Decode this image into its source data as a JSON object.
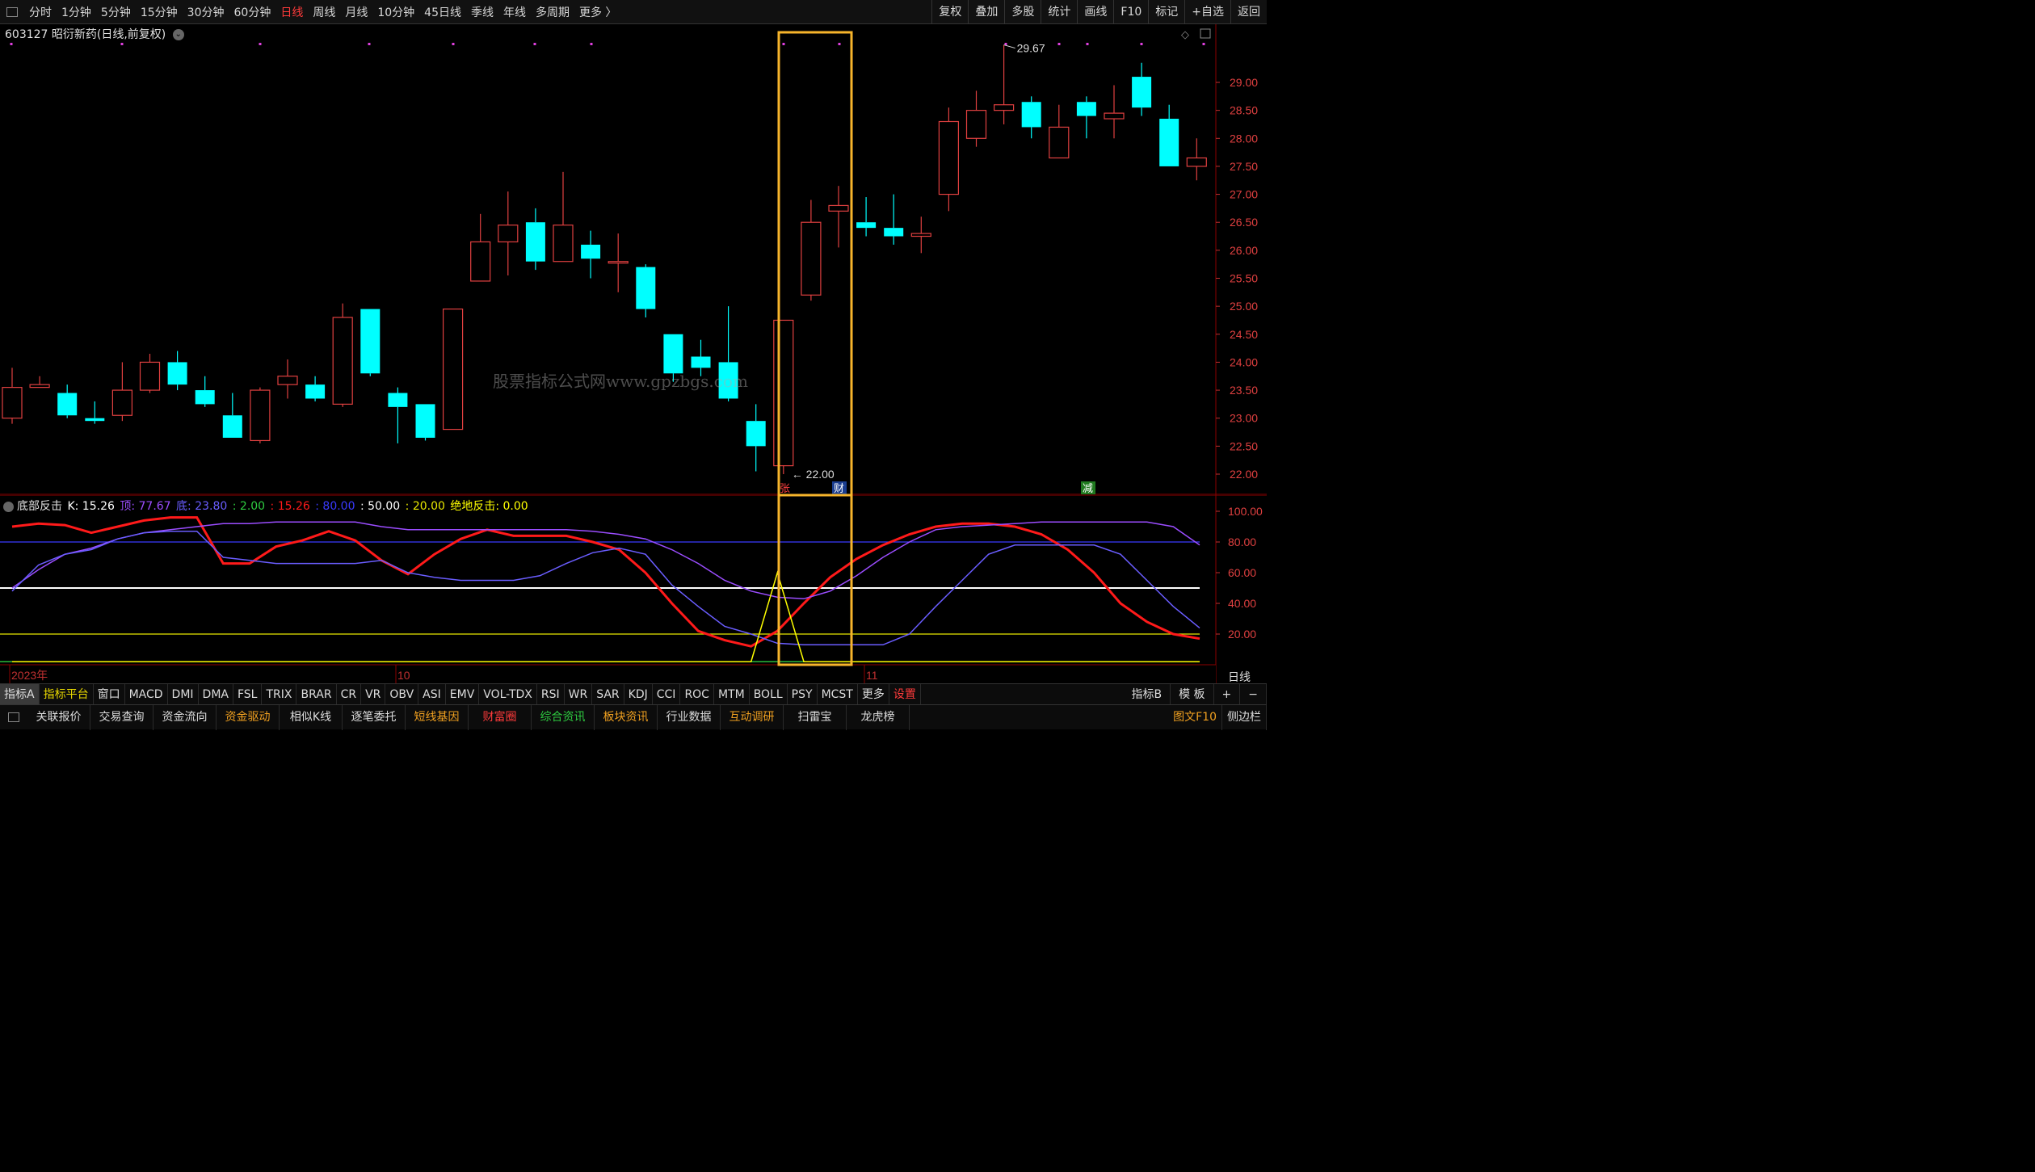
{
  "topbar": {
    "periods": [
      "分时",
      "1分钟",
      "5分钟",
      "15分钟",
      "30分钟",
      "60分钟",
      "日线",
      "周线",
      "月线",
      "10分钟",
      "45日线",
      "季线",
      "年线",
      "多周期",
      "更多 〉"
    ],
    "active": "日线",
    "right_buttons": [
      "复权",
      "叠加",
      "多股",
      "统计",
      "画线",
      "F10",
      "标记",
      "+自选",
      "返回"
    ]
  },
  "stock": {
    "title": "603127 昭衍新药(日线,前复权)",
    "dropdown_icon": "chevron-down-icon"
  },
  "watermark": "股票指标公式网www.gpzbgs.com",
  "colors": {
    "up": "#e04040",
    "down": "#00ffff",
    "highlight": "#f7b52b",
    "k": "#ff1a1a",
    "top": "#9b4dff",
    "bottom": "#5a4dff",
    "signal": "#ffff00",
    "grid_red": "#8b0000"
  },
  "chart_data": [
    {
      "type": "candlestick",
      "title": "603127 昭衍新药(日线,前复权)",
      "y_ticks": [
        "22.00",
        "22.50",
        "23.00",
        "23.50",
        "24.00",
        "24.50",
        "25.00",
        "25.50",
        "26.00",
        "26.50",
        "27.00",
        "27.50",
        "28.00",
        "28.50",
        "29.00"
      ],
      "ylim": [
        21.8,
        29.9
      ],
      "x_labels": [
        "2023年",
        "10",
        "11"
      ],
      "candles": [
        {
          "o": 23.0,
          "h": 23.9,
          "l": 22.9,
          "c": 23.55
        },
        {
          "o": 23.55,
          "h": 23.75,
          "l": 23.55,
          "c": 23.6
        },
        {
          "o": 23.45,
          "h": 23.6,
          "l": 23.0,
          "c": 23.05
        },
        {
          "o": 23.0,
          "h": 23.3,
          "l": 22.9,
          "c": 22.95
        },
        {
          "o": 23.05,
          "h": 24.0,
          "l": 22.95,
          "c": 23.5
        },
        {
          "o": 23.5,
          "h": 24.15,
          "l": 23.45,
          "c": 24.0
        },
        {
          "o": 24.0,
          "h": 24.2,
          "l": 23.5,
          "c": 23.6
        },
        {
          "o": 23.5,
          "h": 23.75,
          "l": 23.2,
          "c": 23.25
        },
        {
          "o": 23.05,
          "h": 23.45,
          "l": 22.65,
          "c": 22.65
        },
        {
          "o": 22.6,
          "h": 23.55,
          "l": 22.55,
          "c": 23.5
        },
        {
          "o": 23.6,
          "h": 24.05,
          "l": 23.35,
          "c": 23.75
        },
        {
          "o": 23.6,
          "h": 23.75,
          "l": 23.3,
          "c": 23.35
        },
        {
          "o": 23.25,
          "h": 25.05,
          "l": 23.2,
          "c": 24.8
        },
        {
          "o": 24.95,
          "h": 24.95,
          "l": 23.75,
          "c": 23.8
        },
        {
          "o": 23.45,
          "h": 23.55,
          "l": 22.55,
          "c": 23.2
        },
        {
          "o": 23.25,
          "h": 23.25,
          "l": 22.6,
          "c": 22.65
        },
        {
          "o": 22.8,
          "h": 24.95,
          "l": 22.8,
          "c": 24.95
        },
        {
          "o": 25.45,
          "h": 26.65,
          "l": 25.45,
          "c": 26.15
        },
        {
          "o": 26.15,
          "h": 27.05,
          "l": 25.55,
          "c": 26.45
        },
        {
          "o": 26.5,
          "h": 26.75,
          "l": 25.65,
          "c": 25.8
        },
        {
          "o": 25.8,
          "h": 27.4,
          "l": 25.8,
          "c": 26.45
        },
        {
          "o": 26.1,
          "h": 26.35,
          "l": 25.5,
          "c": 25.85
        },
        {
          "o": 25.8,
          "h": 26.3,
          "l": 25.25,
          "c": 25.8
        },
        {
          "o": 25.7,
          "h": 25.75,
          "l": 24.8,
          "c": 24.95
        },
        {
          "o": 24.5,
          "h": 24.5,
          "l": 23.65,
          "c": 23.8
        },
        {
          "o": 24.1,
          "h": 24.4,
          "l": 23.75,
          "c": 23.9
        },
        {
          "o": 24.0,
          "h": 25.0,
          "l": 23.3,
          "c": 23.35
        },
        {
          "o": 22.95,
          "h": 23.25,
          "l": 22.05,
          "c": 22.5
        },
        {
          "o": 22.15,
          "h": 24.75,
          "l": 22.0,
          "c": 24.75
        },
        {
          "o": 25.2,
          "h": 26.9,
          "l": 25.1,
          "c": 26.5
        },
        {
          "o": 26.7,
          "h": 27.15,
          "l": 26.05,
          "c": 26.8
        },
        {
          "o": 26.5,
          "h": 26.95,
          "l": 26.25,
          "c": 26.4
        },
        {
          "o": 26.4,
          "h": 27.0,
          "l": 26.1,
          "c": 26.25
        },
        {
          "o": 26.25,
          "h": 26.6,
          "l": 25.95,
          "c": 26.3
        },
        {
          "o": 27.0,
          "h": 28.55,
          "l": 26.7,
          "c": 28.3
        },
        {
          "o": 28.0,
          "h": 28.85,
          "l": 27.85,
          "c": 28.5
        },
        {
          "o": 28.5,
          "h": 29.67,
          "l": 28.25,
          "c": 28.6
        },
        {
          "o": 28.65,
          "h": 28.75,
          "l": 28.0,
          "c": 28.2
        },
        {
          "o": 27.65,
          "h": 28.6,
          "l": 27.65,
          "c": 28.2
        },
        {
          "o": 28.65,
          "h": 28.75,
          "l": 28.0,
          "c": 28.4
        },
        {
          "o": 28.35,
          "h": 28.95,
          "l": 28.0,
          "c": 28.45
        },
        {
          "o": 29.1,
          "h": 29.35,
          "l": 28.4,
          "c": 28.55
        },
        {
          "o": 28.35,
          "h": 28.6,
          "l": 27.5,
          "c": 27.5
        },
        {
          "o": 27.5,
          "h": 28.0,
          "l": 27.25,
          "c": 27.65
        }
      ],
      "annotations": {
        "high": "29.67",
        "low": "22.00",
        "markers": [
          "张",
          "财",
          "减"
        ]
      }
    },
    {
      "type": "line",
      "title": "底部反击",
      "legend": [
        {
          "text": "底部反击",
          "color": "#e0e0e0"
        },
        {
          "text": "K: 15.26",
          "color": "#ffffff"
        },
        {
          "text": "顶: 77.67",
          "color": "#9b4dff"
        },
        {
          "text": "底: 23.80",
          "color": "#6a5dff"
        },
        {
          "text": ": 2.00",
          "color": "#2ecc40"
        },
        {
          "text": ": 15.26",
          "color": "#ff1a1a"
        },
        {
          "text": ": 80.00",
          "color": "#3a3aff"
        },
        {
          "text": ": 50.00",
          "color": "#ffffff"
        },
        {
          "text": ": 20.00",
          "color": "#e8e800"
        },
        {
          "text": "绝地反击: 0.00",
          "color": "#ffff00"
        }
      ],
      "y_ticks": [
        "20.00",
        "40.00",
        "60.00",
        "80.00",
        "100.00"
      ],
      "ylim": [
        0,
        106
      ],
      "hlines": [
        80,
        50,
        20,
        2
      ],
      "series": [
        {
          "name": "K",
          "color": "#ff1a1a",
          "values": [
            90,
            92,
            91,
            86,
            90,
            94,
            96,
            96,
            66,
            66,
            77,
            81,
            87,
            81,
            68,
            59,
            72,
            82,
            88,
            84,
            84,
            84,
            80,
            75,
            60,
            40,
            22,
            16,
            12,
            22,
            40,
            57,
            69,
            78,
            85,
            90,
            92,
            92,
            90,
            85,
            75,
            60,
            40,
            28,
            20,
            17
          ]
        },
        {
          "name": "顶",
          "color": "#9b4dff",
          "values": [
            50,
            62,
            72,
            76,
            82,
            86,
            88,
            90,
            92,
            92,
            93,
            93,
            93,
            93,
            90,
            88,
            88,
            88,
            88,
            88,
            88,
            88,
            87,
            85,
            82,
            75,
            66,
            55,
            48,
            44,
            43,
            48,
            58,
            70,
            80,
            88,
            90,
            91,
            92,
            93,
            93,
            93,
            93,
            93,
            90,
            78
          ]
        },
        {
          "name": "底",
          "color": "#6a5dff",
          "values": [
            48,
            65,
            72,
            75,
            82,
            86,
            87,
            87,
            70,
            68,
            66,
            66,
            66,
            66,
            68,
            60,
            57,
            55,
            55,
            55,
            58,
            66,
            73,
            76,
            72,
            52,
            38,
            25,
            20,
            14,
            13,
            13,
            13,
            13,
            20,
            38,
            55,
            72,
            78,
            78,
            78,
            78,
            72,
            55,
            38,
            24
          ]
        },
        {
          "name": "绝地反击",
          "color": "#ffff00",
          "values": [
            2,
            2,
            2,
            2,
            2,
            2,
            2,
            2,
            2,
            2,
            2,
            2,
            2,
            2,
            2,
            2,
            2,
            2,
            2,
            2,
            2,
            2,
            2,
            2,
            2,
            2,
            2,
            2,
            2,
            60,
            2,
            2,
            2,
            2,
            2,
            2,
            2,
            2,
            2,
            2,
            2,
            2,
            2,
            2,
            2,
            2
          ]
        }
      ]
    }
  ],
  "subaxis_label": "日线",
  "tabs": {
    "items": [
      "指标A",
      "指标平台",
      "窗口",
      "MACD",
      "DMI",
      "DMA",
      "FSL",
      "TRIX",
      "BRAR",
      "CR",
      "VR",
      "OBV",
      "ASI",
      "EMV",
      "VOL-TDX",
      "RSI",
      "WR",
      "SAR",
      "KDJ",
      "CCI",
      "ROC",
      "MTM",
      "BOLL",
      "PSY",
      "MCST",
      "更多",
      "设置"
    ],
    "right": [
      "指标B",
      "模 板",
      "+",
      "−"
    ]
  },
  "bottombar": {
    "items": [
      "关联报价",
      "交易查询",
      "资金流向",
      "资金驱动",
      "相似K线",
      "逐笔委托",
      "短线基因",
      "财富圈",
      "综合资讯",
      "板块资讯",
      "行业数据",
      "互动调研",
      "扫雷宝",
      "龙虎榜"
    ],
    "colors": [
      "#ddd",
      "#ddd",
      "#ddd",
      "#f0a020",
      "#ddd",
      "#ddd",
      "#f0a020",
      "#ff3b3b",
      "#2ecc40",
      "#f0a020",
      "#ddd",
      "#f0a020",
      "#ddd",
      "#ddd"
    ],
    "right": [
      "图文F10",
      "侧边栏"
    ]
  }
}
